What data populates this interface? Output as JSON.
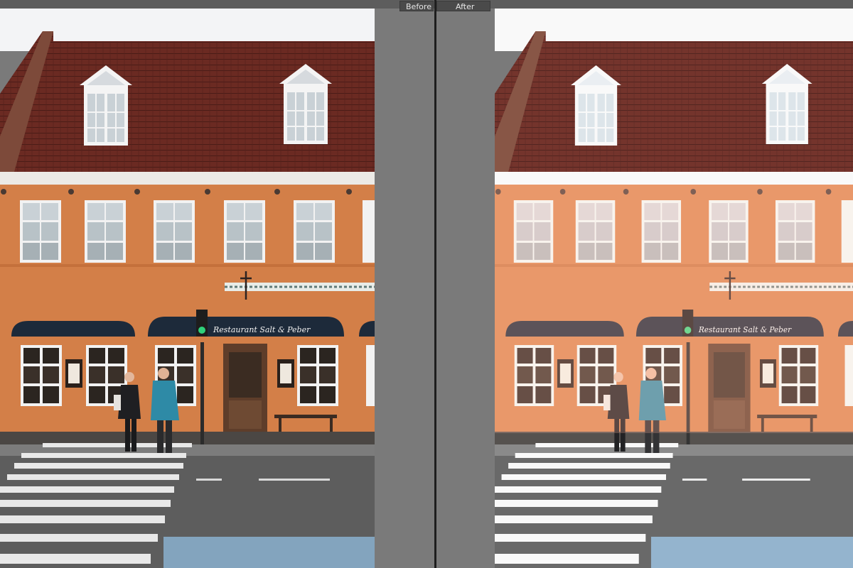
{
  "labels": {
    "before": "Before",
    "after": "After"
  },
  "photo": {
    "sign_text": "Restaurant Salt & Peber"
  },
  "colors": {
    "wall_before": "#d37f48",
    "wall_after": "#e09a7a",
    "roof": "#6b2a22",
    "awning": "#1d2a3a",
    "background_gray": "#7a7a7a"
  }
}
